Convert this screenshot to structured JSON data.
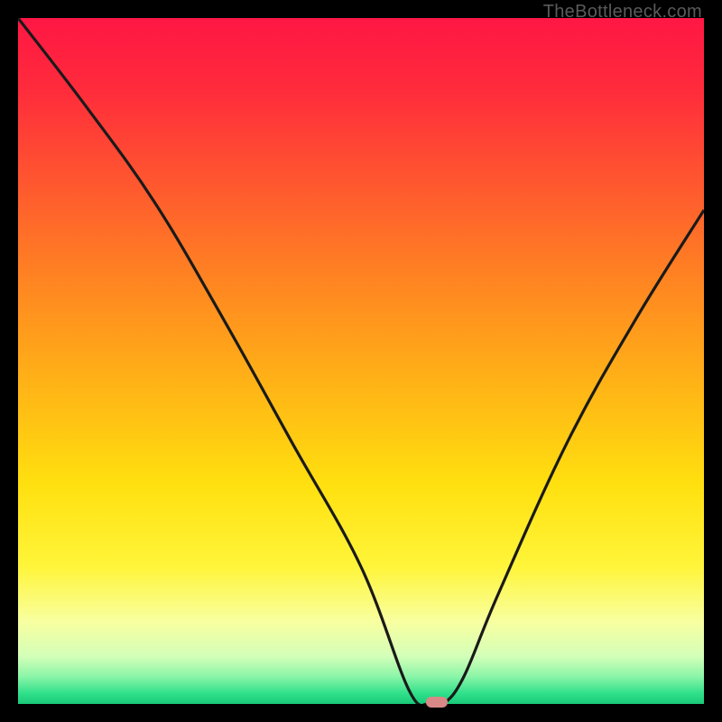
{
  "watermark": "TheBottleneck.com",
  "chart_data": {
    "type": "line",
    "title": "",
    "xlabel": "",
    "ylabel": "",
    "xlim": [
      0,
      100
    ],
    "ylim": [
      0,
      100
    ],
    "series": [
      {
        "name": "bottleneck-curve",
        "x": [
          0,
          10,
          20,
          30,
          40,
          50,
          57,
          60,
          62,
          65,
          70,
          80,
          90,
          100
        ],
        "values": [
          100,
          87,
          73,
          56,
          38,
          20,
          2,
          0,
          0,
          4,
          16,
          38,
          56,
          72
        ]
      }
    ],
    "marker": {
      "x": 61,
      "y": 0,
      "label": "optimal-point"
    },
    "gradient_stops": [
      {
        "pos": 0.0,
        "color": "#ff1744"
      },
      {
        "pos": 0.1,
        "color": "#ff2a3c"
      },
      {
        "pos": 0.25,
        "color": "#ff5a2e"
      },
      {
        "pos": 0.4,
        "color": "#ff8a20"
      },
      {
        "pos": 0.55,
        "color": "#ffb815"
      },
      {
        "pos": 0.68,
        "color": "#ffe00f"
      },
      {
        "pos": 0.8,
        "color": "#fff53a"
      },
      {
        "pos": 0.88,
        "color": "#f8ffa0"
      },
      {
        "pos": 0.93,
        "color": "#d4ffb8"
      },
      {
        "pos": 0.96,
        "color": "#8bf5a8"
      },
      {
        "pos": 0.985,
        "color": "#2fe08a"
      },
      {
        "pos": 1.0,
        "color": "#19c877"
      }
    ]
  }
}
